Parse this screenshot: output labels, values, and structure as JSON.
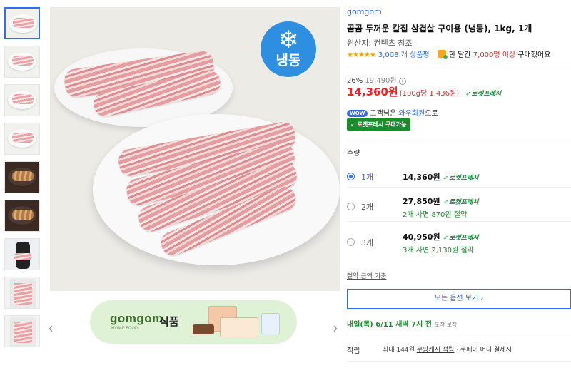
{
  "thumbnails": [
    {
      "kind": "plate",
      "active": true
    },
    {
      "kind": "plate",
      "active": false
    },
    {
      "kind": "plate",
      "active": false
    },
    {
      "kind": "plate",
      "active": false
    },
    {
      "kind": "dark",
      "active": false
    },
    {
      "kind": "dark",
      "active": false
    },
    {
      "kind": "person",
      "active": false
    },
    {
      "kind": "pack",
      "active": false
    },
    {
      "kind": "pack",
      "active": false
    }
  ],
  "main_image": {
    "badge_icon": "snowflake-icon",
    "badge_text": "냉동"
  },
  "banner": {
    "logo": "gomgom",
    "logo_sub": "HOME FOOD",
    "text": "식품"
  },
  "product": {
    "brand": "gomgom",
    "title": "곰곰 두꺼운 칼집 삼겹살 구이용 (냉동), 1kg, 1개",
    "origin": "원산지: 컨텐츠 참조",
    "stars": "★★★★★",
    "rating_fraction": 0.9,
    "review_count": "3,008 개 상품평",
    "buy_prefix": "한 달간",
    "buy_count": "7,000명 이상",
    "buy_suffix": "구매했어요",
    "discount_rate": "26%",
    "original_price": "19,490원",
    "price": "14,360원",
    "unit_price": "(100g당 1,436원)",
    "rocket_fresh": "로켓프레시",
    "wow_badge": "WOW",
    "wow_prefix": "고객님은",
    "wow_member": "와우회원",
    "wow_suffix": "으로",
    "fresh_available": "✓ 로켓프레시 구매가능"
  },
  "quantity": {
    "label": "수량",
    "options": [
      {
        "qty": "1개",
        "price": "14,360원",
        "save": "",
        "selected": true
      },
      {
        "qty": "2개",
        "price": "27,850원",
        "save": "2개 사면 870원 절약",
        "selected": false
      },
      {
        "qty": "3개",
        "price": "40,950원",
        "save": "3개 사면 2,130원 절약",
        "selected": false
      }
    ]
  },
  "basis": "절약 금액 기준",
  "all_options_button": "모든 옵션 보기 ›",
  "delivery": {
    "text": "내일(목) 6/11 새벽 7시 전",
    "note": "도착 보장"
  },
  "cash": {
    "label": "적립",
    "prefix": "최대 144원",
    "link": "쿠팡캐시 적립",
    "suffix": "· 쿠페이 머니 결제시"
  },
  "colors": {
    "accent": "#346aff",
    "price_red": "#e52528",
    "fresh_green": "#1e8a2e",
    "freeze_blue": "#2e8fe0",
    "banner_bg": "#dff2d6"
  }
}
